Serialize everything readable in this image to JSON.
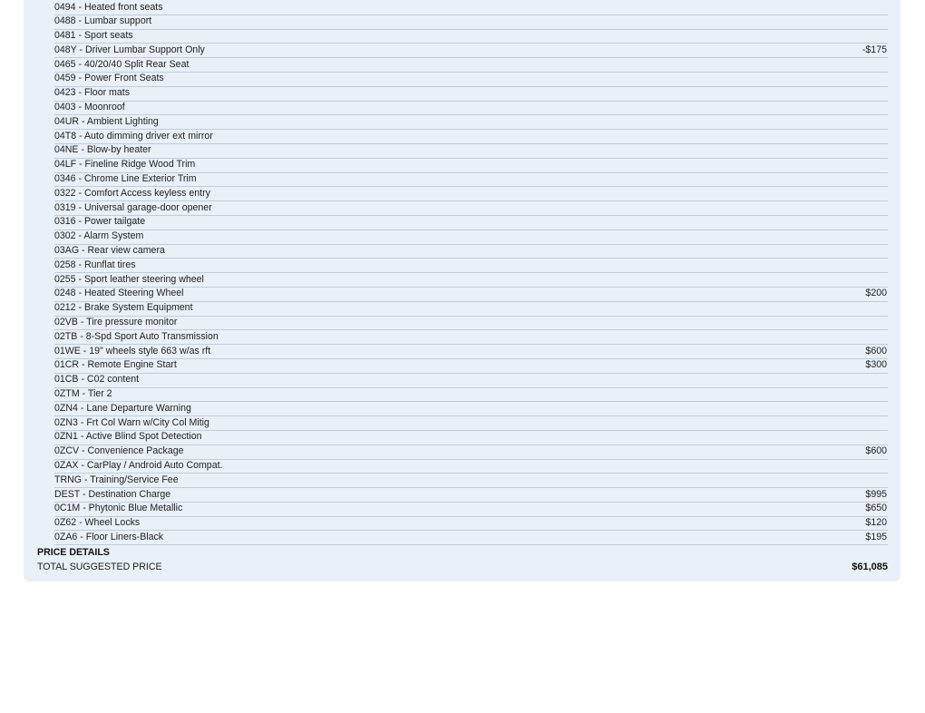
{
  "options": [
    {
      "text": "0494 - Heated front seats",
      "price": ""
    },
    {
      "text": "0488 - Lumbar support",
      "price": ""
    },
    {
      "text": "0481 - Sport seats",
      "price": ""
    },
    {
      "text": "048Y - Driver Lumbar Support Only",
      "price": "-$175"
    },
    {
      "text": "0465 - 40/20/40 Split Rear Seat",
      "price": ""
    },
    {
      "text": "0459 - Power Front Seats",
      "price": ""
    },
    {
      "text": "0423 - Floor mats",
      "price": ""
    },
    {
      "text": "0403 - Moonroof",
      "price": ""
    },
    {
      "text": "04UR - Ambient Lighting",
      "price": ""
    },
    {
      "text": "04T8 - Auto dimming driver ext mirror",
      "price": ""
    },
    {
      "text": "04NE - Blow-by heater",
      "price": ""
    },
    {
      "text": "04LF - Fineline Ridge Wood Trim",
      "price": ""
    },
    {
      "text": "0346 - Chrome Line Exterior Trim",
      "price": ""
    },
    {
      "text": "0322 - Comfort Access keyless entry",
      "price": ""
    },
    {
      "text": "0319 - Universal garage-door opener",
      "price": ""
    },
    {
      "text": "0316 - Power tailgate",
      "price": ""
    },
    {
      "text": "0302 - Alarm System",
      "price": ""
    },
    {
      "text": "03AG - Rear view camera",
      "price": ""
    },
    {
      "text": "0258 - Runflat tires",
      "price": ""
    },
    {
      "text": "0255 - Sport leather steering wheel",
      "price": ""
    },
    {
      "text": "0248 - Heated Steering Wheel",
      "price": "$200"
    },
    {
      "text": "0212 - Brake System Equipment",
      "price": ""
    },
    {
      "text": "02VB - Tire pressure monitor",
      "price": ""
    },
    {
      "text": "02TB - 8-Spd Sport Auto Transmission",
      "price": ""
    },
    {
      "text": "01WE - 19\" wheels style 663 w/as rft",
      "price": "$600"
    },
    {
      "text": "01CR - Remote Engine Start",
      "price": "$300"
    },
    {
      "text": "01CB - C02 content",
      "price": ""
    },
    {
      "text": "0ZTM - Tier 2",
      "price": ""
    },
    {
      "text": "0ZN4 - Lane Departure Warning",
      "price": ""
    },
    {
      "text": "0ZN3 - Frt Col Warn w/City Col Mitig",
      "price": ""
    },
    {
      "text": "0ZN1 - Active Blind Spot Detection",
      "price": ""
    },
    {
      "text": "0ZCV - Convenience Package",
      "price": "$600"
    },
    {
      "text": "0ZAX - CarPlay / Android Auto Compat.",
      "price": ""
    },
    {
      "text": "TRNG - Training/Service Fee",
      "price": ""
    },
    {
      "text": "DEST - Destination Charge",
      "price": "$995"
    },
    {
      "text": "0C1M - Phytonic Blue Metallic",
      "price": "$650"
    },
    {
      "text": "0Z62 - Wheel Locks",
      "price": "$120"
    },
    {
      "text": "0ZA6 - Floor Liners-Black",
      "price": "$195"
    }
  ],
  "price_details": {
    "heading": "PRICE DETAILS",
    "total_label": "TOTAL SUGGESTED PRICE",
    "total_value": "$61,085"
  },
  "colors": {
    "panel_background": "#e9f0f8",
    "row_divider": "#c3ccd6",
    "text": "#1b1b1b"
  }
}
